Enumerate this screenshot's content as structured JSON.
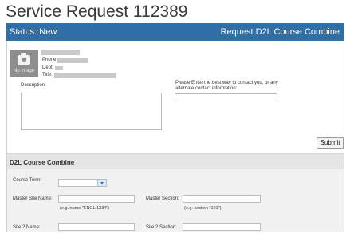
{
  "page": {
    "title": "Service Request 112389"
  },
  "status_bar": {
    "status": "Status: New",
    "request_type": "Request D2L Course Combine"
  },
  "requester": {
    "avatar_text": "No Image",
    "phone_label": "Phone:",
    "dept_label": "Dept:",
    "title_label": "Title:"
  },
  "description": {
    "label": "Description:"
  },
  "contact": {
    "label": "Please Enter the best way to contact you, or any alternate contact information:"
  },
  "submit_label": "Submit",
  "d2l_section": {
    "title": "D2L Course Combine",
    "course_term_label": "Course Term:",
    "master_site_name_label": "Master Site Name:",
    "master_site_name_hint": "(e.g. name \"ENGL 1234\")",
    "master_section_label": "Master Section:",
    "master_section_hint": "(e.g. section \"101\")",
    "site2_name_label": "Site 2 Name:",
    "site2_section_label": "Site 2 Section:"
  }
}
